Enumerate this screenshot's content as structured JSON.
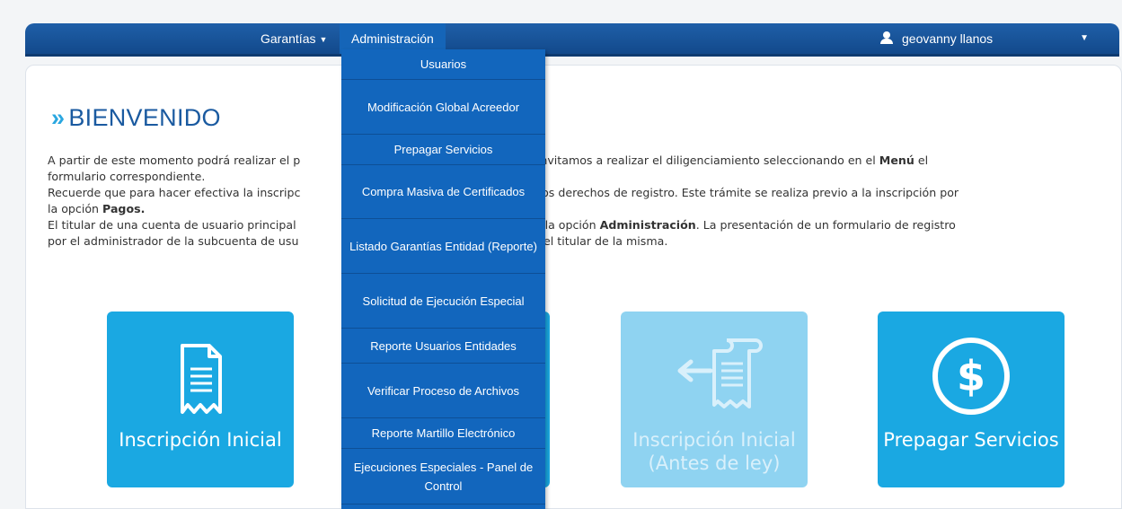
{
  "nav": {
    "garantias": "Garantías",
    "caret": "▼",
    "administracion": "Administración",
    "user_name": "geovanny llanos",
    "user_caret": "▼"
  },
  "welcome": {
    "chevron": "»",
    "title": "BIENVENIDO"
  },
  "paragraph": {
    "line1_a": "A partir de este momento podrá realizar el p",
    "line1_b": "ularios. Lo invitamos a realizar el diligenciamiento seleccionando en el ",
    "line1_bold": "Menú",
    "line1_c": " el",
    "line2": "formulario correspondiente.",
    "line3_a": "Recuerde que para hacer efectiva la inscripc",
    "line3_b": "ago de los derechos de registro. Este trámite se realiza previo a la inscripción por",
    "line4_a": "la opción ",
    "line4_bold": "Pagos.",
    "line5_a": "El titular de una cuenta de usuario principal",
    "line5_b": "uario por la opción ",
    "line5_bold": "Administración",
    "line5_c": ". La presentación de un formulario de registro",
    "line6_a": "por el administrador de la subcuenta de usu",
    "line6_b": "a por el titular de la misma."
  },
  "tiles": [
    {
      "label": "Inscripción Inicial",
      "icon": "document-icon",
      "enabled": true
    },
    {
      "label": "Inscripción Inicial (Antes de ley)",
      "icon": "document-import-icon",
      "enabled": false
    },
    {
      "label": "Prepagar Servicios",
      "icon": "dollar-circle-icon",
      "enabled": true
    }
  ],
  "dropdown": {
    "items": [
      "Usuarios",
      "Modificación Global Acreedor",
      "Prepagar Servicios",
      "Compra Masiva de Certificados",
      "Listado Garantías Entidad (Reporte)",
      "Solicitud de Ejecución Especial",
      "Reporte Usuarios Entidades",
      "Verificar Proceso de Archivos",
      "Reporte Martillo Electrónico",
      "Ejecuciones Especiales - Panel de Control"
    ]
  },
  "colors": {
    "navbar": "#12498b",
    "accent": "#1aa8e2",
    "accent_disabled": "#8fd3f1",
    "dropdown": "#1266bd",
    "title": "#1a5aa0"
  }
}
